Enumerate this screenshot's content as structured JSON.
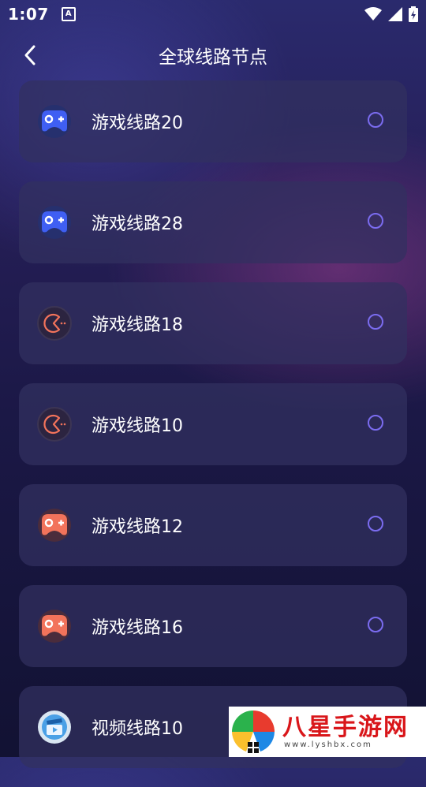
{
  "status_bar": {
    "time": "1:07",
    "notification_icon": "A"
  },
  "header": {
    "title": "全球线路节点",
    "back_icon": "chevron-left-icon"
  },
  "routes": [
    {
      "label": "游戏线路20",
      "icon": "gamepad-blue-icon",
      "selected": false
    },
    {
      "label": "游戏线路28",
      "icon": "gamepad-blue-icon",
      "selected": false
    },
    {
      "label": "游戏线路18",
      "icon": "pacman-outline-icon",
      "selected": false
    },
    {
      "label": "游戏线路10",
      "icon": "pacman-outline-icon",
      "selected": false
    },
    {
      "label": "游戏线路12",
      "icon": "gamepad-orange-icon",
      "selected": false
    },
    {
      "label": "游戏线路16",
      "icon": "gamepad-orange-icon",
      "selected": false
    },
    {
      "label": "视频线路10",
      "icon": "video-clapper-icon",
      "selected": false
    }
  ],
  "watermark": {
    "text": "八星手游网",
    "sub": "www.lyshbx.com"
  },
  "colors": {
    "accent": "#7b6cf0",
    "card_bg": "#32305f",
    "blue_icon": "#3f5ff3",
    "orange_icon": "#f2735b"
  }
}
